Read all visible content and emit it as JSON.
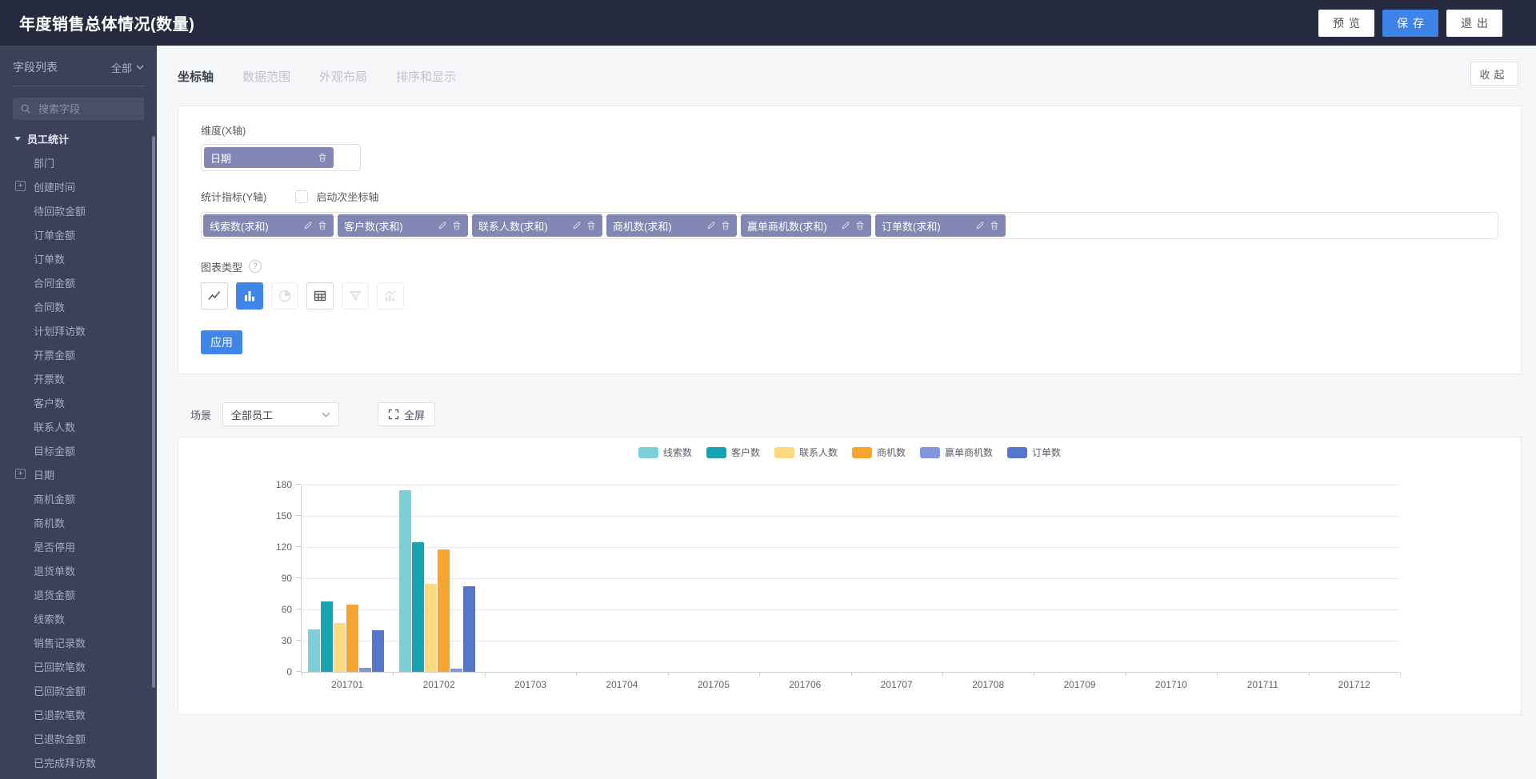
{
  "header": {
    "title": "年度销售总体情况(数量)",
    "preview_label": "预览",
    "save_label": "保存",
    "exit_label": "退出"
  },
  "sidebar": {
    "title": "字段列表",
    "filter_label": "全部",
    "search_placeholder": "搜索字段",
    "group_label": "员工统计",
    "expand_glyph": "+",
    "items": [
      {
        "label": "部门",
        "expandable": false
      },
      {
        "label": "创建时间",
        "expandable": true
      },
      {
        "label": "待回款金额",
        "expandable": false
      },
      {
        "label": "订单金额",
        "expandable": false
      },
      {
        "label": "订单数",
        "expandable": false
      },
      {
        "label": "合同金额",
        "expandable": false
      },
      {
        "label": "合同数",
        "expandable": false
      },
      {
        "label": "计划拜访数",
        "expandable": false
      },
      {
        "label": "开票金额",
        "expandable": false
      },
      {
        "label": "开票数",
        "expandable": false
      },
      {
        "label": "客户数",
        "expandable": false
      },
      {
        "label": "联系人数",
        "expandable": false
      },
      {
        "label": "目标金额",
        "expandable": false
      },
      {
        "label": "日期",
        "expandable": true
      },
      {
        "label": "商机金额",
        "expandable": false
      },
      {
        "label": "商机数",
        "expandable": false
      },
      {
        "label": "是否停用",
        "expandable": false
      },
      {
        "label": "退货单数",
        "expandable": false
      },
      {
        "label": "退货金额",
        "expandable": false
      },
      {
        "label": "线索数",
        "expandable": false
      },
      {
        "label": "销售记录数",
        "expandable": false
      },
      {
        "label": "已回款笔数",
        "expandable": false
      },
      {
        "label": "已回款金额",
        "expandable": false
      },
      {
        "label": "已退款笔数",
        "expandable": false
      },
      {
        "label": "已退款金额",
        "expandable": false
      },
      {
        "label": "已完成拜访数",
        "expandable": false
      }
    ]
  },
  "tabs": {
    "items": [
      "坐标轴",
      "数据范围",
      "外观布局",
      "排序和显示"
    ],
    "active_index": 0,
    "collapse_label": "收起"
  },
  "config": {
    "dimension_label": "维度(X轴)",
    "dimension_tag": "日期",
    "measures_label": "统计指标(Y轴)",
    "secondary_axis_label": "启动次坐标轴",
    "secondary_axis_checked": false,
    "measure_tags": [
      "线索数(求和)",
      "客户数(求和)",
      "联系人数(求和)",
      "商机数(求和)",
      "赢单商机数(求和)",
      "订单数(求和)"
    ],
    "chart_type_label": "图表类型",
    "help_glyph": "?",
    "chart_types": [
      {
        "name": "line",
        "state": "normal"
      },
      {
        "name": "bar",
        "state": "selected"
      },
      {
        "name": "pie",
        "state": "disabled"
      },
      {
        "name": "table",
        "state": "normal"
      },
      {
        "name": "funnel",
        "state": "disabled"
      },
      {
        "name": "combo",
        "state": "disabled"
      }
    ],
    "apply_label": "应用"
  },
  "scene": {
    "label": "场景",
    "value": "全部员工",
    "fullscreen_label": "全屏"
  },
  "chart_data": {
    "type": "bar",
    "title": "",
    "categories": [
      "201701",
      "201702",
      "201703",
      "201704",
      "201705",
      "201706",
      "201707",
      "201708",
      "201709",
      "201710",
      "201711",
      "201712"
    ],
    "series": [
      {
        "name": "线索数",
        "color": "#7bcfd6",
        "values": [
          41,
          175,
          0,
          0,
          0,
          0,
          0,
          0,
          0,
          0,
          0,
          0
        ]
      },
      {
        "name": "客户数",
        "color": "#16a3b2",
        "values": [
          68,
          125,
          0,
          0,
          0,
          0,
          0,
          0,
          0,
          0,
          0,
          0
        ]
      },
      {
        "name": "联系人数",
        "color": "#fcd87f",
        "values": [
          47,
          85,
          0,
          0,
          0,
          0,
          0,
          0,
          0,
          0,
          0,
          0
        ]
      },
      {
        "name": "商机数",
        "color": "#f8a42e",
        "values": [
          65,
          118,
          0,
          0,
          0,
          0,
          0,
          0,
          0,
          0,
          0,
          0
        ]
      },
      {
        "name": "赢单商机数",
        "color": "#8095da",
        "values": [
          4,
          3,
          0,
          0,
          0,
          0,
          0,
          0,
          0,
          0,
          0,
          0
        ]
      },
      {
        "name": "订单数",
        "color": "#5477cb",
        "values": [
          40,
          82,
          0,
          0,
          0,
          0,
          0,
          0,
          0,
          0,
          0,
          0
        ]
      }
    ],
    "ylim": [
      0,
      180
    ],
    "yticks": [
      0,
      30,
      60,
      90,
      120,
      150,
      180
    ],
    "xlabel": "",
    "ylabel": "",
    "grid": true,
    "legend_position": "top"
  }
}
